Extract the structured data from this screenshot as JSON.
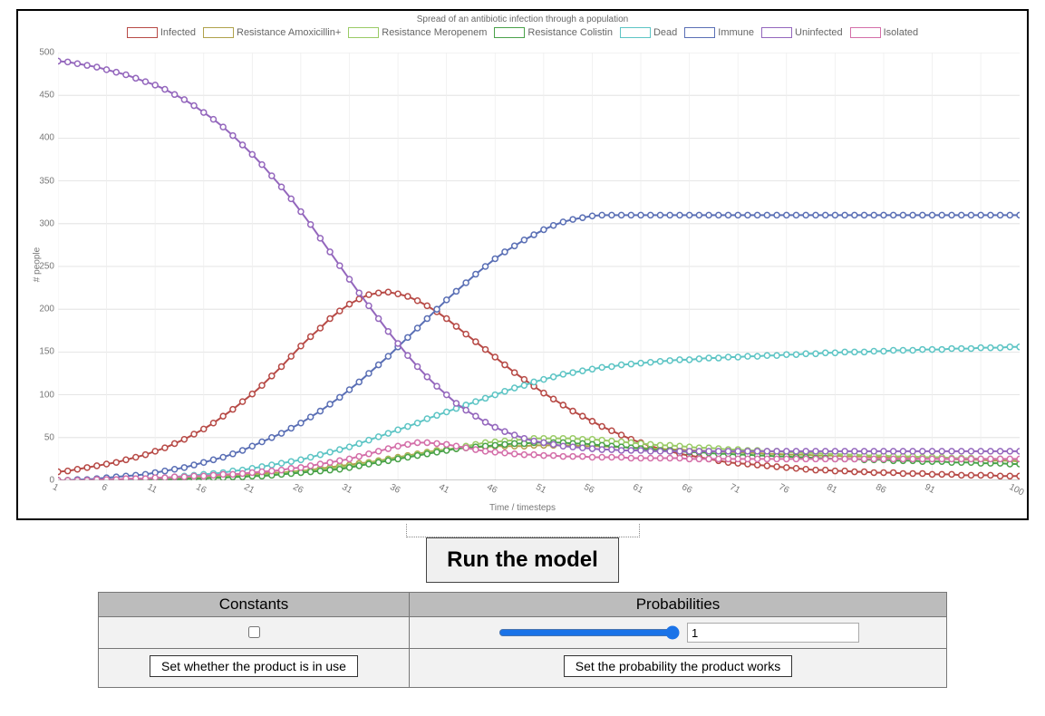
{
  "chart_data": {
    "type": "line",
    "title": "Spread of an antibiotic infection through a population",
    "xlabel": "Time / timesteps",
    "ylabel": "# people",
    "xlim": [
      1,
      100
    ],
    "ylim": [
      0,
      500
    ],
    "yticks": [
      0,
      50,
      100,
      150,
      200,
      250,
      300,
      350,
      400,
      450,
      500
    ],
    "xticks": [
      1,
      6,
      11,
      16,
      21,
      26,
      31,
      36,
      41,
      46,
      51,
      56,
      61,
      66,
      71,
      76,
      81,
      86,
      91,
      100
    ],
    "x": [
      1,
      2,
      3,
      4,
      5,
      6,
      7,
      8,
      9,
      10,
      11,
      12,
      13,
      14,
      15,
      16,
      17,
      18,
      19,
      20,
      21,
      22,
      23,
      24,
      25,
      26,
      27,
      28,
      29,
      30,
      31,
      32,
      33,
      34,
      35,
      36,
      37,
      38,
      39,
      40,
      41,
      42,
      43,
      44,
      45,
      46,
      47,
      48,
      49,
      50,
      51,
      52,
      53,
      54,
      55,
      56,
      57,
      58,
      59,
      60,
      61,
      62,
      63,
      64,
      65,
      66,
      67,
      68,
      69,
      70,
      71,
      72,
      73,
      74,
      75,
      76,
      77,
      78,
      79,
      80,
      81,
      82,
      83,
      84,
      85,
      86,
      87,
      88,
      89,
      90,
      91,
      92,
      93,
      94,
      95,
      96,
      97,
      98,
      99,
      100
    ],
    "series": [
      {
        "name": "Infected",
        "color": "#b74a46",
        "values": [
          10,
          11,
          13,
          15,
          17,
          19,
          21,
          24,
          27,
          30,
          34,
          38,
          43,
          48,
          54,
          60,
          67,
          75,
          83,
          92,
          101,
          111,
          122,
          133,
          145,
          157,
          168,
          178,
          189,
          198,
          206,
          212,
          217,
          219,
          220,
          218,
          215,
          210,
          204,
          197,
          189,
          180,
          171,
          162,
          153,
          144,
          135,
          126,
          118,
          110,
          102,
          95,
          88,
          81,
          75,
          69,
          63,
          58,
          53,
          48,
          44,
          40,
          37,
          34,
          31,
          29,
          27,
          25,
          23,
          21,
          20,
          19,
          18,
          17,
          16,
          15,
          14,
          13,
          12,
          12,
          11,
          11,
          10,
          10,
          9,
          9,
          9,
          8,
          8,
          8,
          7,
          7,
          7,
          6,
          6,
          6,
          6,
          5,
          5,
          5
        ]
      },
      {
        "name": "Resistance Amoxicillin+",
        "color": "#b0a24c",
        "values": [
          0,
          0,
          0,
          0,
          0,
          1,
          1,
          1,
          1,
          2,
          2,
          2,
          3,
          3,
          4,
          4,
          5,
          5,
          6,
          6,
          7,
          8,
          9,
          9,
          10,
          11,
          12,
          14,
          15,
          17,
          18,
          20,
          21,
          23,
          25,
          27,
          29,
          31,
          33,
          35,
          36,
          37,
          38,
          39,
          39,
          40,
          40,
          40,
          40,
          41,
          41,
          41,
          41,
          41,
          40,
          40,
          40,
          39,
          39,
          38,
          38,
          37,
          37,
          36,
          36,
          35,
          35,
          34,
          34,
          33,
          33,
          32,
          32,
          31,
          31,
          30,
          30,
          30,
          29,
          29,
          29,
          28,
          28,
          28,
          27,
          27,
          27,
          26,
          26,
          26,
          25,
          25,
          25,
          24,
          24,
          24,
          23,
          23,
          23,
          22
        ]
      },
      {
        "name": "Resistance Meropenem",
        "color": "#9acb66",
        "values": [
          0,
          0,
          0,
          0,
          0,
          0,
          0,
          0,
          1,
          1,
          1,
          1,
          2,
          2,
          2,
          3,
          3,
          4,
          4,
          5,
          5,
          6,
          7,
          8,
          9,
          10,
          11,
          12,
          13,
          15,
          16,
          18,
          20,
          22,
          24,
          26,
          28,
          30,
          32,
          34,
          36,
          38,
          40,
          42,
          44,
          45,
          46,
          47,
          48,
          49,
          49,
          49,
          49,
          49,
          48,
          48,
          47,
          46,
          45,
          44,
          43,
          42,
          41,
          41,
          40,
          39,
          38,
          38,
          37,
          36,
          36,
          35,
          35,
          34,
          34,
          33,
          33,
          32,
          32,
          31,
          31,
          30,
          30,
          29,
          29,
          29,
          28,
          28,
          28,
          27,
          27,
          27,
          26,
          26,
          26,
          25,
          25,
          25,
          24,
          24
        ]
      },
      {
        "name": "Resistance Colistin",
        "color": "#4aa24a",
        "values": [
          0,
          0,
          0,
          0,
          0,
          0,
          0,
          0,
          0,
          1,
          1,
          1,
          1,
          2,
          2,
          2,
          3,
          3,
          4,
          4,
          5,
          5,
          6,
          7,
          8,
          9,
          10,
          11,
          12,
          13,
          15,
          17,
          19,
          21,
          23,
          25,
          27,
          29,
          31,
          33,
          35,
          37,
          38,
          39,
          40,
          41,
          42,
          43,
          43,
          44,
          44,
          44,
          44,
          43,
          43,
          42,
          41,
          40,
          39,
          38,
          37,
          36,
          35,
          35,
          34,
          33,
          33,
          32,
          31,
          31,
          30,
          30,
          29,
          29,
          28,
          28,
          27,
          27,
          26,
          26,
          25,
          25,
          25,
          24,
          24,
          24,
          23,
          23,
          23,
          22,
          22,
          22,
          21,
          21,
          21,
          20,
          20,
          20,
          19,
          19
        ]
      },
      {
        "name": "Dead",
        "color": "#5ec5c5",
        "values": [
          0,
          0,
          0,
          0,
          0,
          1,
          1,
          1,
          2,
          2,
          3,
          3,
          4,
          5,
          6,
          7,
          8,
          9,
          11,
          12,
          14,
          16,
          18,
          20,
          22,
          24,
          27,
          30,
          33,
          36,
          39,
          43,
          47,
          51,
          55,
          59,
          63,
          67,
          72,
          76,
          80,
          84,
          88,
          92,
          96,
          100,
          104,
          108,
          111,
          115,
          118,
          121,
          124,
          126,
          128,
          130,
          132,
          133,
          135,
          136,
          137,
          138,
          139,
          140,
          141,
          141,
          142,
          143,
          143,
          144,
          144,
          145,
          145,
          146,
          146,
          147,
          147,
          148,
          148,
          149,
          149,
          150,
          150,
          150,
          151,
          151,
          152,
          152,
          152,
          153,
          153,
          153,
          154,
          154,
          154,
          155,
          155,
          155,
          156,
          156
        ]
      },
      {
        "name": "Immune",
        "color": "#5a6fb5",
        "values": [
          0,
          0,
          1,
          1,
          2,
          3,
          4,
          5,
          6,
          7,
          9,
          11,
          13,
          15,
          18,
          21,
          24,
          27,
          31,
          35,
          40,
          45,
          50,
          55,
          61,
          67,
          74,
          81,
          89,
          97,
          106,
          115,
          125,
          135,
          145,
          156,
          167,
          178,
          189,
          200,
          211,
          221,
          231,
          241,
          250,
          259,
          267,
          274,
          281,
          287,
          293,
          298,
          302,
          305,
          307,
          309,
          310,
          310,
          310,
          310,
          310,
          310,
          310,
          310,
          310,
          310,
          310,
          310,
          310,
          310,
          310,
          310,
          310,
          310,
          310,
          310,
          310,
          310,
          310,
          310,
          310,
          310,
          310,
          310,
          310,
          310,
          310,
          310,
          310,
          310,
          310,
          310,
          310,
          310,
          310,
          310,
          310,
          310,
          310,
          310
        ]
      },
      {
        "name": "Uninfected",
        "color": "#9467bd",
        "values": [
          490,
          489,
          487,
          485,
          483,
          480,
          477,
          474,
          470,
          466,
          462,
          457,
          451,
          445,
          438,
          430,
          422,
          413,
          403,
          392,
          381,
          369,
          356,
          343,
          329,
          314,
          299,
          283,
          267,
          251,
          235,
          219,
          204,
          189,
          174,
          160,
          146,
          133,
          121,
          110,
          100,
          90,
          82,
          75,
          68,
          62,
          57,
          53,
          49,
          46,
          44,
          42,
          40,
          39,
          38,
          37,
          36,
          36,
          35,
          35,
          35,
          34,
          34,
          34,
          34,
          34,
          34,
          34,
          34,
          34,
          34,
          34,
          34,
          34,
          34,
          34,
          34,
          34,
          34,
          34,
          34,
          34,
          34,
          34,
          34,
          34,
          34,
          34,
          34,
          34,
          34,
          34,
          34,
          34,
          34,
          34,
          34,
          34,
          34,
          34
        ]
      },
      {
        "name": "Isolated",
        "color": "#d46fa9",
        "values": [
          0,
          0,
          0,
          0,
          1,
          1,
          1,
          2,
          2,
          2,
          3,
          3,
          4,
          4,
          5,
          5,
          6,
          7,
          7,
          8,
          9,
          10,
          11,
          12,
          14,
          15,
          17,
          19,
          21,
          23,
          25,
          28,
          31,
          34,
          37,
          40,
          42,
          44,
          44,
          43,
          42,
          40,
          38,
          36,
          34,
          33,
          32,
          31,
          30,
          30,
          29,
          29,
          28,
          28,
          28,
          27,
          27,
          27,
          27,
          26,
          26,
          26,
          26,
          26,
          26,
          25,
          25,
          25,
          25,
          25,
          25,
          25,
          25,
          25,
          25,
          25,
          25,
          25,
          25,
          25,
          25,
          25,
          25,
          25,
          25,
          25,
          25,
          25,
          25,
          25,
          25,
          25,
          25,
          25,
          25,
          25,
          25,
          25,
          25,
          25
        ]
      }
    ]
  },
  "controls": {
    "run_button": "Run the model",
    "headers": {
      "left": "Constants",
      "right": "Probabilities"
    },
    "left": {
      "checkbox_checked": false,
      "caption": "Set whether the product is in use"
    },
    "right": {
      "slider_min": 0,
      "slider_max": 1,
      "slider_value": 1,
      "number_value": 1,
      "caption": "Set the probability the product works"
    }
  }
}
